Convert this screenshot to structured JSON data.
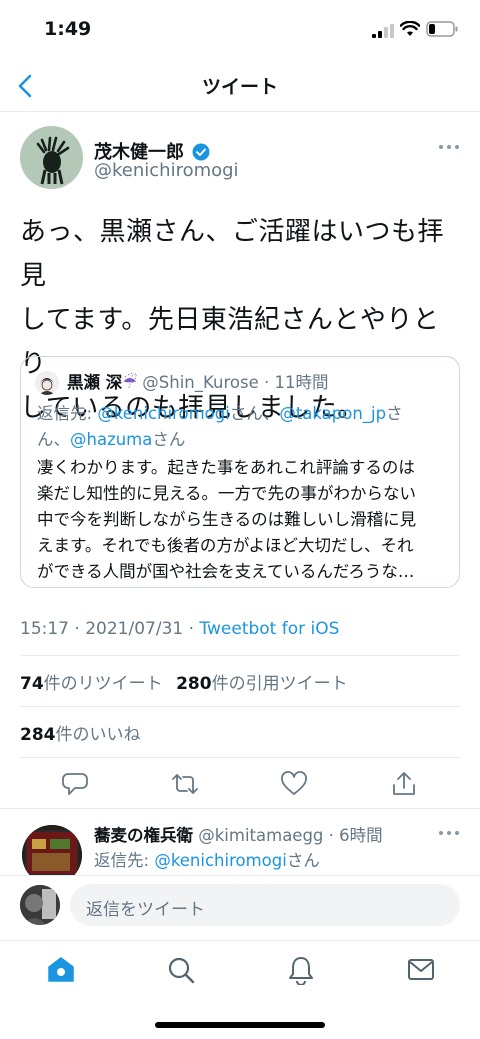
{
  "status": {
    "time": "1:49"
  },
  "nav": {
    "title": "ツイート"
  },
  "tweet": {
    "author_name": "茂木健一郎",
    "author_handle": "@kenichiromogi",
    "text_lines": [
      "あっ、黒瀬さん、ご活躍はいつも拝見",
      "してます。先日東浩紀さんとやりとり",
      "しているのも拝見しました。"
    ],
    "time": "15:17",
    "date": "2021/07/31",
    "separator": "·",
    "client": "Tweetbot for iOS"
  },
  "quote": {
    "author_name": "黒瀬 深",
    "author_emoji": "☔",
    "author_handle": "@Shin_Kurose",
    "separator": "·",
    "age": "11時間",
    "reply_prefix": "返信先: ",
    "reply_mention_1": "@kenichiromogi",
    "reply_suffix_1": "さん、",
    "reply_mention_2": "@takapon_jp",
    "reply_suffix_2": "さ",
    "reply_line2_prefix": "ん、",
    "reply_mention_3": "@hazuma",
    "reply_suffix_3": "さん",
    "body_lines": [
      "凄くわかります。起きた事をあれこれ評論するのは",
      "楽だし知性的に見える。一方で先の事がわからない",
      "中で今を判断しながら生きるのは難しいし滑稽に見",
      "えます。それでも後者の方がよほど大切だし、それ",
      "ができる人間が国や社会を支えているんだろうな…"
    ]
  },
  "stats": {
    "retweets_count": "74",
    "retweets_label": "件のリツイート",
    "quotes_count": "280",
    "quotes_label": "件の引用ツイート",
    "likes_count": "284",
    "likes_label": "件のいいね"
  },
  "reply": {
    "author_name": "蕎麦の権兵衛",
    "author_handle": "@kimitamaegg",
    "separator": "·",
    "age": "6時間",
    "reply_prefix": "返信先: ",
    "reply_mention": "@kenichiromogi",
    "reply_suffix": "さん"
  },
  "composer": {
    "placeholder": "返信をツイート"
  },
  "tabs": [
    "home-icon",
    "search-icon",
    "notifications-icon",
    "messages-icon"
  ],
  "colors": {
    "accent": "#1b95e0",
    "text": "#0f1419",
    "secondary": "#657786"
  }
}
